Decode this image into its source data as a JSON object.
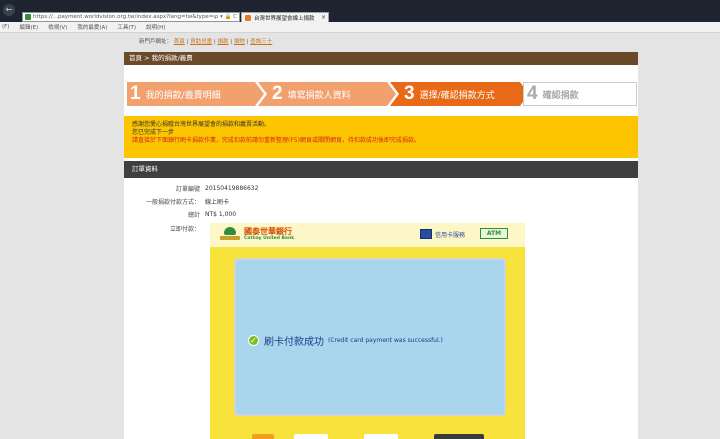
{
  "browser": {
    "url": "https://...payment.worldvision.org.tw/index.aspx?lang=tw&type=cart",
    "tab_title": "台灣世界展望會線上捐款",
    "close_glyph": "×",
    "back_glyph": "←",
    "forward_glyph": "→",
    "address_tools": "ρ ▾ 🔒 C",
    "menu": [
      "(F)",
      "編輯(E)",
      "檢視(V)",
      "我的最愛(A)",
      "工具(T)",
      "說明(H)"
    ]
  },
  "page": {
    "top_breadcrumb_label": "新門戶網址：",
    "top_breadcrumb_links": [
      "首頁",
      "資助兒童",
      "捐款",
      "捐物",
      "查詢三十"
    ],
    "breadcrumb": "首頁 > 我的捐款/義賣",
    "steps": [
      {
        "num": "1",
        "label": "我的捐款/義賣明細"
      },
      {
        "num": "2",
        "label": "填寫捐款人資料"
      },
      {
        "num": "3",
        "label": "選擇/確認捐款方式"
      },
      {
        "num": "4",
        "label": "確認捐款"
      }
    ],
    "notice": {
      "line1": "感謝您愛心捐贈台灣世界展望會的捐款和義賣活動。",
      "line2": "您已完成下一步",
      "line3": "請直接於下面銀行刷卡捐款作業，完成扣款前請勿重新整理(F5)網頁或關閉網頁，待扣款成功後即完成捐款。"
    },
    "order": {
      "header": "訂單資料",
      "rows": [
        {
          "key": "訂單編號",
          "value": "20150419886632"
        },
        {
          "key": "一般捐款付款方式：",
          "value": "線上刷卡"
        },
        {
          "key": "總計",
          "value": "NT$ 1,000"
        },
        {
          "key": "立即付款：",
          "value": ""
        }
      ]
    },
    "bank": {
      "name_zh": "國泰世華銀行",
      "name_en": "Cathay United Bank",
      "card_link": "信用卡服務",
      "atm": "ATM",
      "success_zh": "刷卡付款成功",
      "success_en": "(Credit card payment was successful.)",
      "check_glyph": "✓"
    }
  },
  "colors": {
    "accent_orange": "#e86a19",
    "step_inactive": "#f2a16e",
    "notice_yellow": "#fdc400",
    "header_dark": "#3f3f3f",
    "breadcrumb_brown": "#6b4a2a",
    "bank_yellow": "#f8e23c",
    "screen_blue": "#a9d6ec"
  },
  "icons": [
    "back-icon",
    "forward-icon",
    "lock-icon",
    "favicon",
    "close-icon",
    "cathay-bank-logo-icon",
    "card-service-icon",
    "atm-icon",
    "check-icon"
  ]
}
